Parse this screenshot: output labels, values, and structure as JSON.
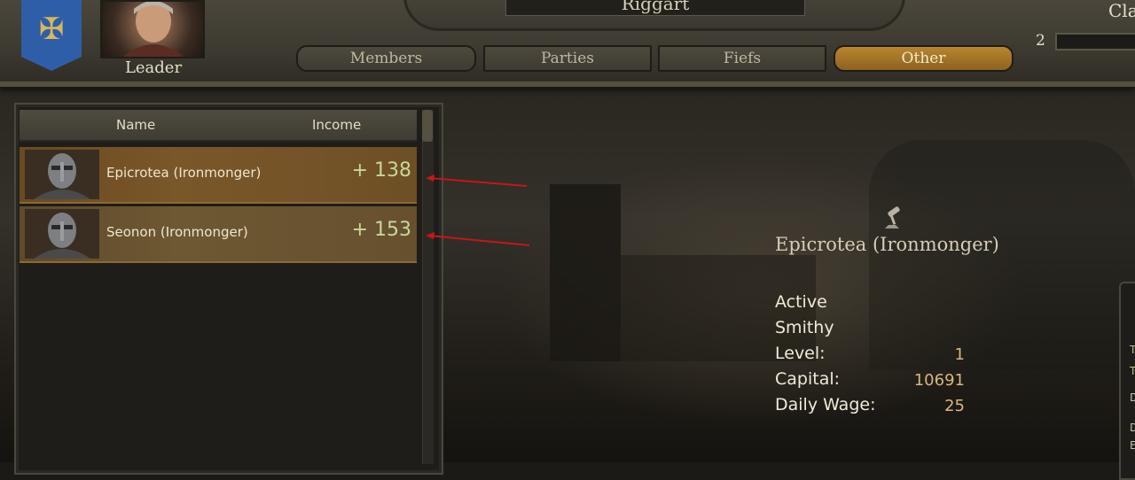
{
  "header": {
    "clan_name": "Riggart",
    "leader_label": "Leader",
    "clan_label_partial": "Cla",
    "tier_number": "2",
    "tabs": [
      {
        "label": "Members",
        "active": false
      },
      {
        "label": "Parties",
        "active": false
      },
      {
        "label": "Fiefs",
        "active": false
      },
      {
        "label": "Other",
        "active": true
      }
    ]
  },
  "list": {
    "columns": {
      "name": "Name",
      "income": "Income"
    },
    "rows": [
      {
        "name": "Epicrotea (Ironmonger)",
        "income": "+ 138"
      },
      {
        "name": "Seonon (Ironmonger)",
        "income": "+ 153"
      }
    ]
  },
  "detail": {
    "title": "Epicrotea (Ironmonger)",
    "status": "Active",
    "workshop_type": "Smithy",
    "fields": [
      {
        "label": "Level:",
        "value": "1"
      },
      {
        "label": "Capital:",
        "value": "10691"
      },
      {
        "label": "Daily Wage:",
        "value": "25"
      }
    ],
    "side_letters": [
      "T",
      "T",
      "D",
      "D",
      "E"
    ]
  },
  "colors": {
    "accent_gold": "#b8862e",
    "income_green": "#c8d79a",
    "value_gold": "#d8b77e",
    "annotation_red": "#c41818",
    "banner_blue": "#2f5ea8"
  },
  "icons": [
    "eagle-emblem-icon",
    "helmet-avatar-icon",
    "anvil-hammer-icon",
    "red-arrow-annotation"
  ]
}
